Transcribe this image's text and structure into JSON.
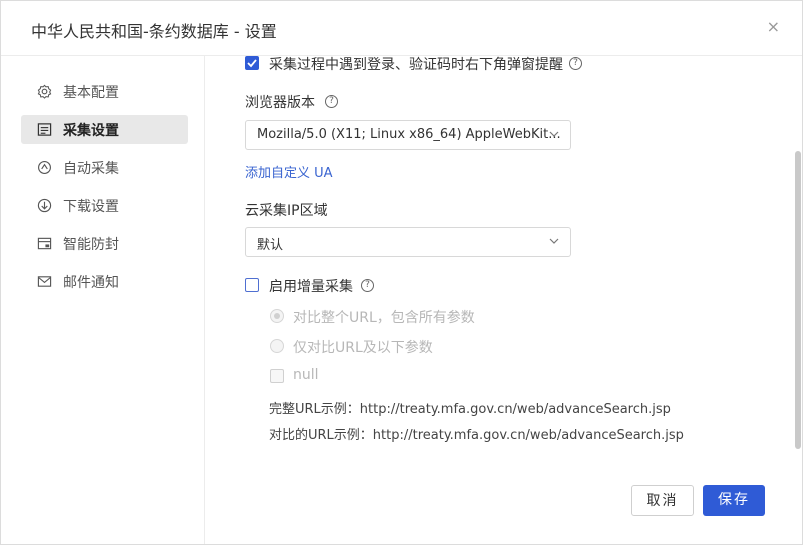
{
  "header": {
    "title": "中华人民共和国-条约数据库 - 设置",
    "close_label": "×"
  },
  "sidebar": {
    "items": [
      {
        "label": "基本配置",
        "icon": "gear-icon"
      },
      {
        "label": "采集设置",
        "icon": "list-icon",
        "active": true
      },
      {
        "label": "自动采集",
        "icon": "auto-icon"
      },
      {
        "label": "下载设置",
        "icon": "download-icon"
      },
      {
        "label": "智能防封",
        "icon": "shield-icon"
      },
      {
        "label": "邮件通知",
        "icon": "mail-icon"
      }
    ]
  },
  "content": {
    "popup_alert_label": "采集过程中遇到登录、验证码时右下角弹窗提醒",
    "browser_version_label": "浏览器版本",
    "browser_version_value": "Mozilla/5.0 (X11; Linux x86_64) AppleWebKit...",
    "add_ua_link": "添加自定义 UA",
    "cloud_ip_label": "云采集IP区域",
    "cloud_ip_value": "默认",
    "incremental_label": "启用增量采集",
    "compare_full_url": "对比整个URL，包含所有参数",
    "compare_partial_url": "仅对比URL及以下参数",
    "param_null": "null",
    "full_url_example": "完整URL示例：http://treaty.mfa.gov.cn/web/advanceSearch.jsp",
    "compare_url_example": "对比的URL示例：http://treaty.mfa.gov.cn/web/advanceSearch.jsp",
    "help_glyph": "?"
  },
  "footer": {
    "cancel_label": "取消",
    "save_label": "保存"
  },
  "colors": {
    "accent": "#2f5bd6",
    "link": "#3a64d0"
  }
}
